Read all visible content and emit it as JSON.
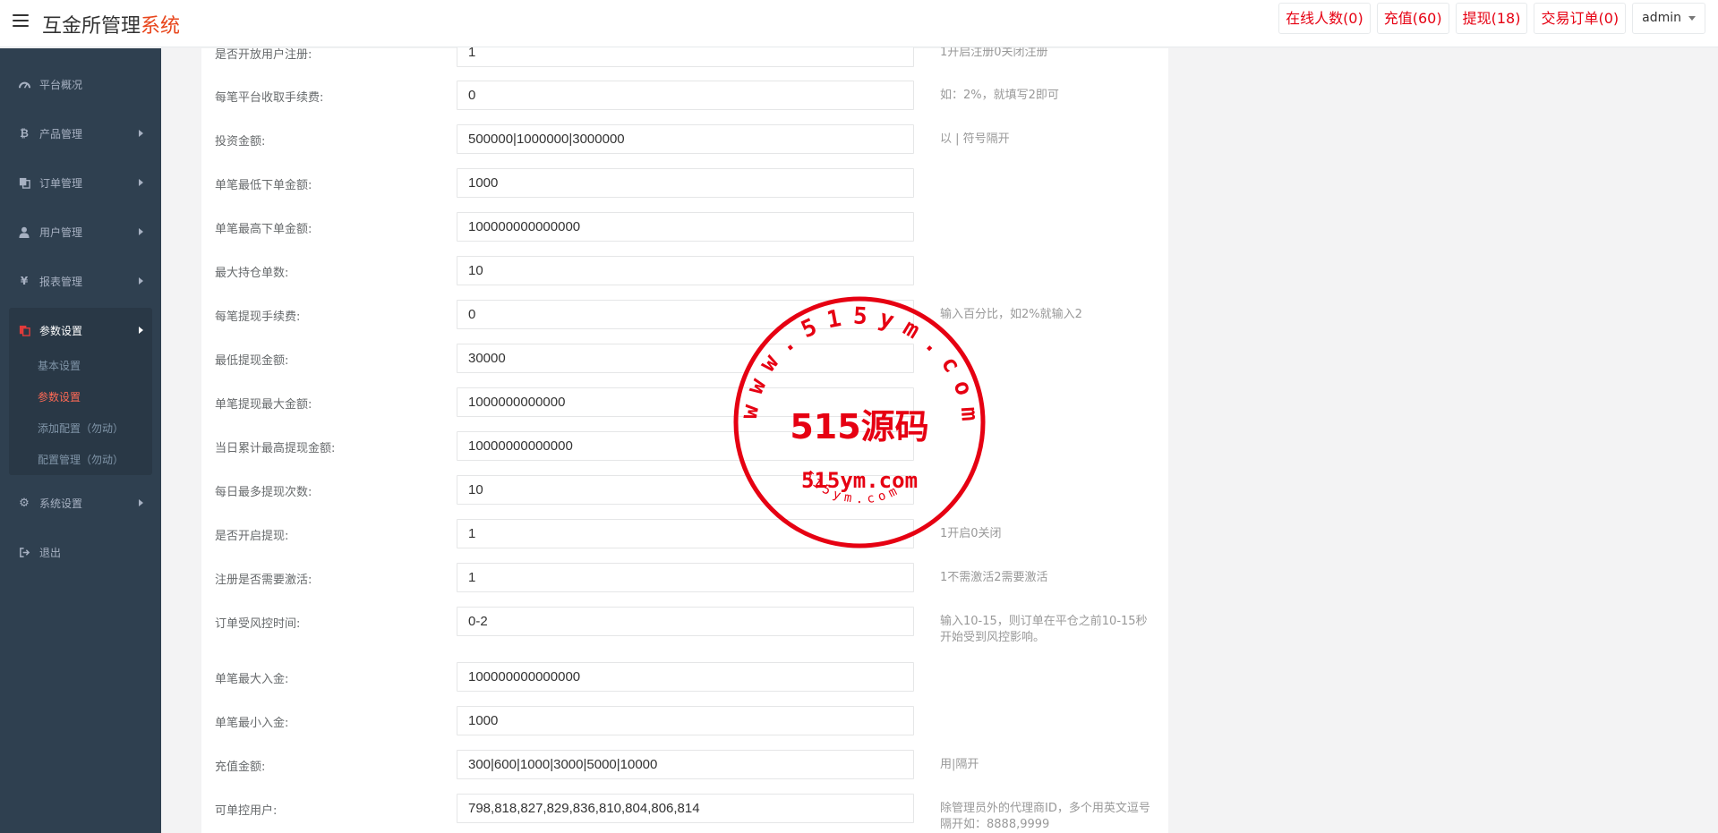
{
  "header": {
    "brand_main": "互金所管理",
    "brand_accent": "系统",
    "buttons": [
      {
        "label": "在线人数(0)"
      },
      {
        "label": "充值(60)"
      },
      {
        "label": "提现(18)"
      },
      {
        "label": "交易订单(0)"
      }
    ],
    "user": "admin"
  },
  "sidebar": {
    "items": [
      {
        "label": "平台概况",
        "icon": "dashboard-icon"
      },
      {
        "label": "产品管理",
        "icon": "bitcoin-icon"
      },
      {
        "label": "订单管理",
        "icon": "copy-icon"
      },
      {
        "label": "用户管理",
        "icon": "user-icon"
      },
      {
        "label": "报表管理",
        "icon": "yen-icon"
      },
      {
        "label": "参数设置",
        "icon": "files-icon"
      },
      {
        "label": "系统设置",
        "icon": "cogs-icon"
      },
      {
        "label": "退出",
        "icon": "sign-out-icon"
      }
    ],
    "sub_items": [
      {
        "label": "基本设置"
      },
      {
        "label": "参数设置"
      },
      {
        "label": "添加配置（勿动）"
      },
      {
        "label": "配置管理（勿动）"
      }
    ]
  },
  "form": {
    "rows": [
      {
        "label": "是否开放用户注册:",
        "value": "1",
        "hint": "1开启注册0关闭注册"
      },
      {
        "label": "每笔平台收取手续费:",
        "value": "0",
        "hint": "如：2%，就填写2即可"
      },
      {
        "label": "投资金额:",
        "value": "500000|1000000|3000000",
        "hint": "以 | 符号隔开"
      },
      {
        "label": "单笔最低下单金额:",
        "value": "1000",
        "hint": ""
      },
      {
        "label": "单笔最高下单金额:",
        "value": "100000000000000",
        "hint": ""
      },
      {
        "label": "最大持仓单数:",
        "value": "10",
        "hint": ""
      },
      {
        "label": "每笔提现手续费:",
        "value": "0",
        "hint": "输入百分比，如2%就输入2"
      },
      {
        "label": "最低提现金额:",
        "value": "30000",
        "hint": ""
      },
      {
        "label": "单笔提现最大金额:",
        "value": "1000000000000",
        "hint": ""
      },
      {
        "label": "当日累计最高提现金额:",
        "value": "10000000000000",
        "hint": ""
      },
      {
        "label": "每日最多提现次数:",
        "value": "10",
        "hint": ""
      },
      {
        "label": "是否开启提现:",
        "value": "1",
        "hint": "1开启0关闭"
      },
      {
        "label": "注册是否需要激活:",
        "value": "1",
        "hint": "1不需激活2需要激活"
      },
      {
        "label": "订单受风控时间:",
        "value": "0-2",
        "hint": "输入10-15，则订单在平仓之前10-15秒开始受到风控影响。"
      },
      {
        "label": "单笔最大入金:",
        "value": "100000000000000",
        "hint": ""
      },
      {
        "label": "单笔最小入金:",
        "value": "1000",
        "hint": ""
      },
      {
        "label": "充值金额:",
        "value": "300|600|1000|3000|5000|10000",
        "hint": "用|隔开"
      },
      {
        "label": "可单控用户:",
        "value": "798,818,827,829,836,810,804,806,814",
        "hint": "除管理员外的代理商ID，多个用英文逗号隔开如：8888,9999"
      }
    ]
  },
  "watermark": {
    "center_text": "515源码",
    "domain_text": "515ym.com",
    "ring_text": "www.515ym.com",
    "small_ring_text": "515ym.com",
    "color": "#e60012"
  },
  "colors": {
    "sidebar_bg": "#2f4050",
    "accent_red": "#e60012",
    "brand_accent": "#e8461c",
    "active_sub": "#ff6a55"
  }
}
